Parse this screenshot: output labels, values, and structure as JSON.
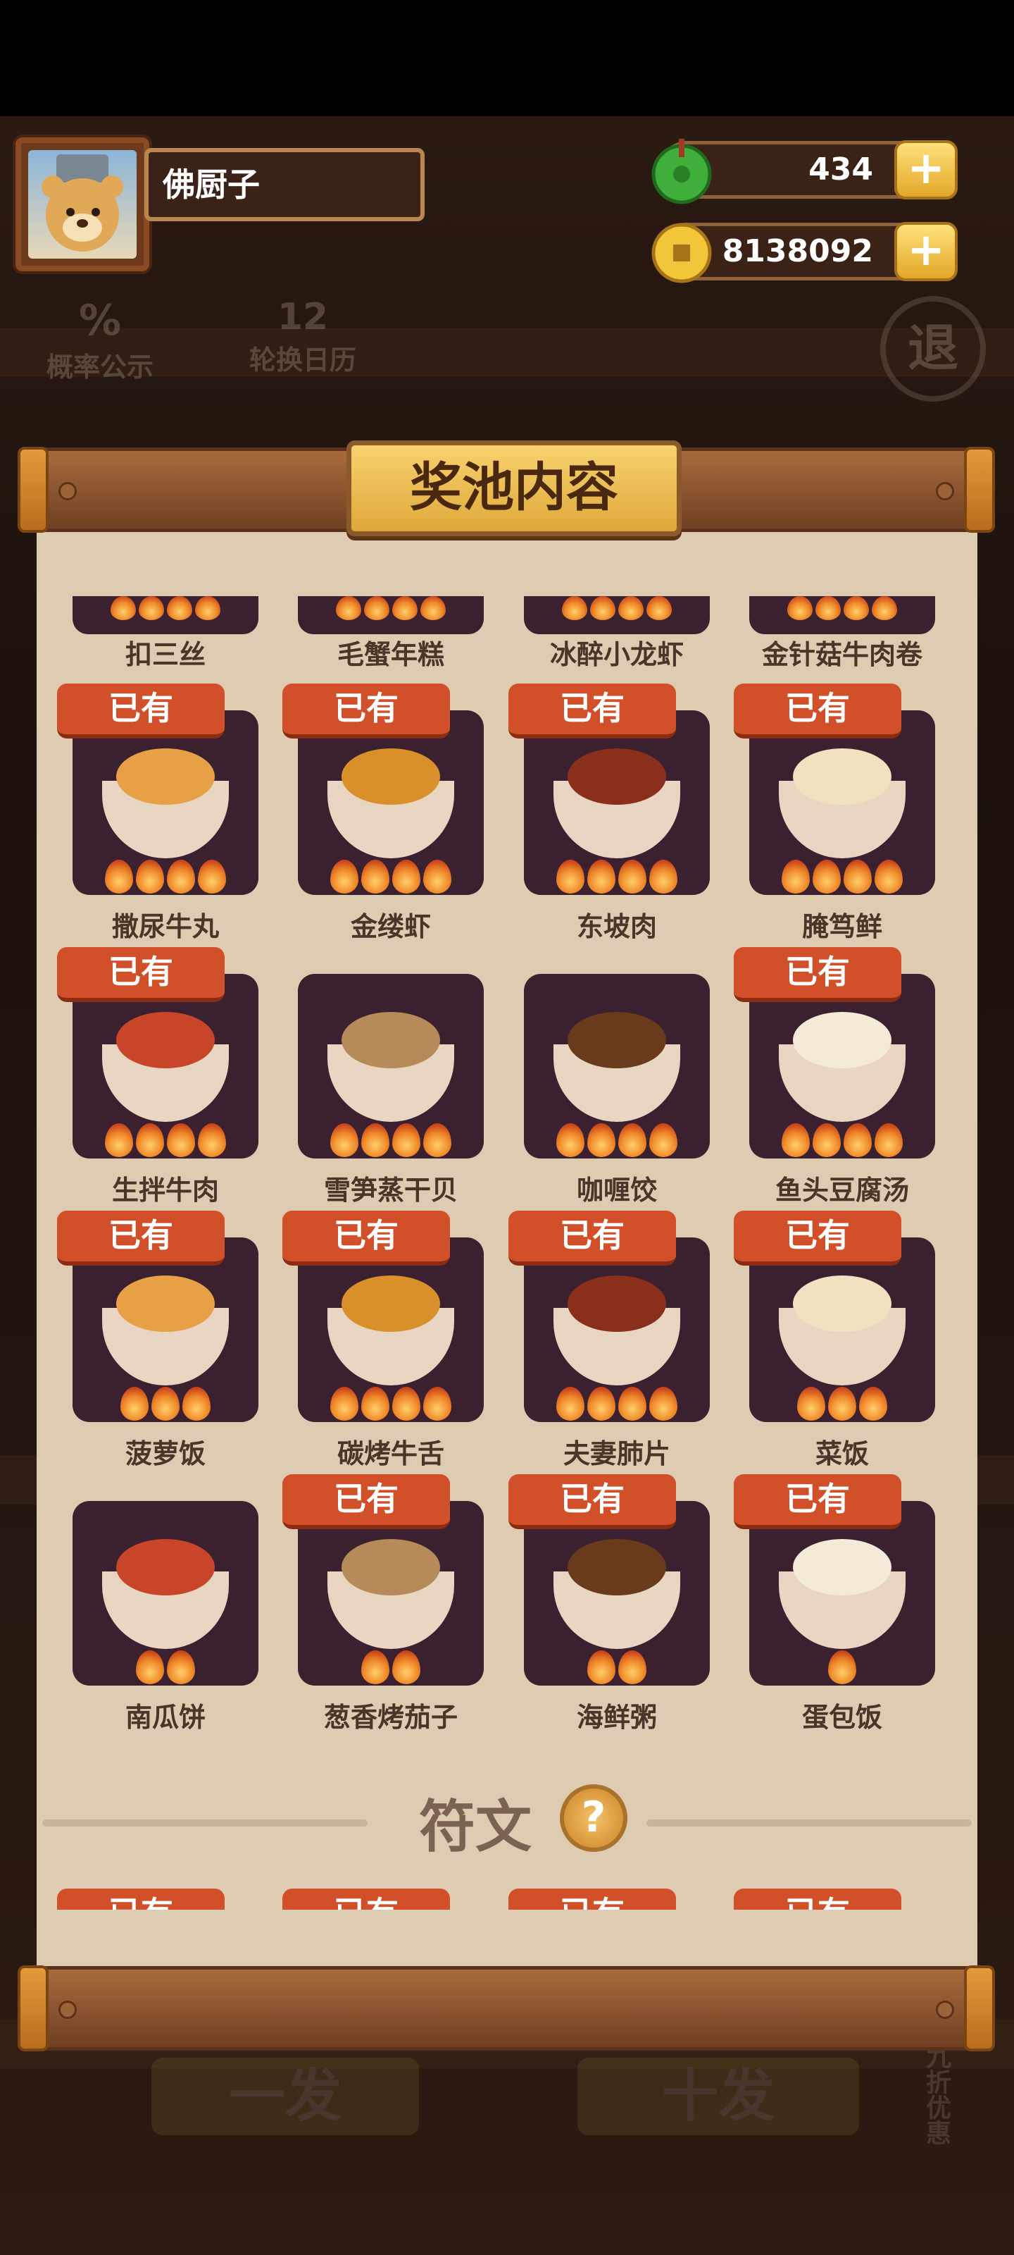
{
  "player": {
    "name": "佛厨子"
  },
  "currencies": [
    {
      "icon": "jade-coin-icon",
      "value": "434"
    },
    {
      "icon": "gold-coin-icon",
      "value": "8138092"
    }
  ],
  "hud": {
    "probability": "概率公示",
    "calendar": "轮换日历",
    "calendar_num": "12",
    "exit": "退"
  },
  "bottom_bg": {
    "one": "一发",
    "ten": "十发",
    "discount": "九折优惠"
  },
  "panel": {
    "title": "奖池内容"
  },
  "owned_label": "已有",
  "top_row": [
    "扣三丝",
    "毛蟹年糕",
    "冰醉小龙虾",
    "金针菇牛肉卷"
  ],
  "rows": [
    [
      {
        "name": "撒尿牛丸",
        "owned": true,
        "stars": 4
      },
      {
        "name": "金缕虾",
        "owned": true,
        "stars": 4
      },
      {
        "name": "东坡肉",
        "owned": true,
        "stars": 4
      },
      {
        "name": "腌笃鲜",
        "owned": true,
        "stars": 4
      }
    ],
    [
      {
        "name": "生拌牛肉",
        "owned": true,
        "stars": 4
      },
      {
        "name": "雪笋蒸干贝",
        "owned": false,
        "stars": 4
      },
      {
        "name": "咖喱饺",
        "owned": false,
        "stars": 4
      },
      {
        "name": "鱼头豆腐汤",
        "owned": true,
        "stars": 4
      }
    ],
    [
      {
        "name": "菠萝饭",
        "owned": true,
        "stars": 3
      },
      {
        "name": "碳烤牛舌",
        "owned": true,
        "stars": 4
      },
      {
        "name": "夫妻肺片",
        "owned": true,
        "stars": 4
      },
      {
        "name": "菜饭",
        "owned": true,
        "stars": 3
      }
    ],
    [
      {
        "name": "南瓜饼",
        "owned": false,
        "stars": 2
      },
      {
        "name": "葱香烤茄子",
        "owned": true,
        "stars": 2
      },
      {
        "name": "海鲜粥",
        "owned": true,
        "stars": 2
      },
      {
        "name": "蛋包饭",
        "owned": true,
        "stars": 1
      }
    ]
  ],
  "section": {
    "title": "符文",
    "help": "?"
  }
}
